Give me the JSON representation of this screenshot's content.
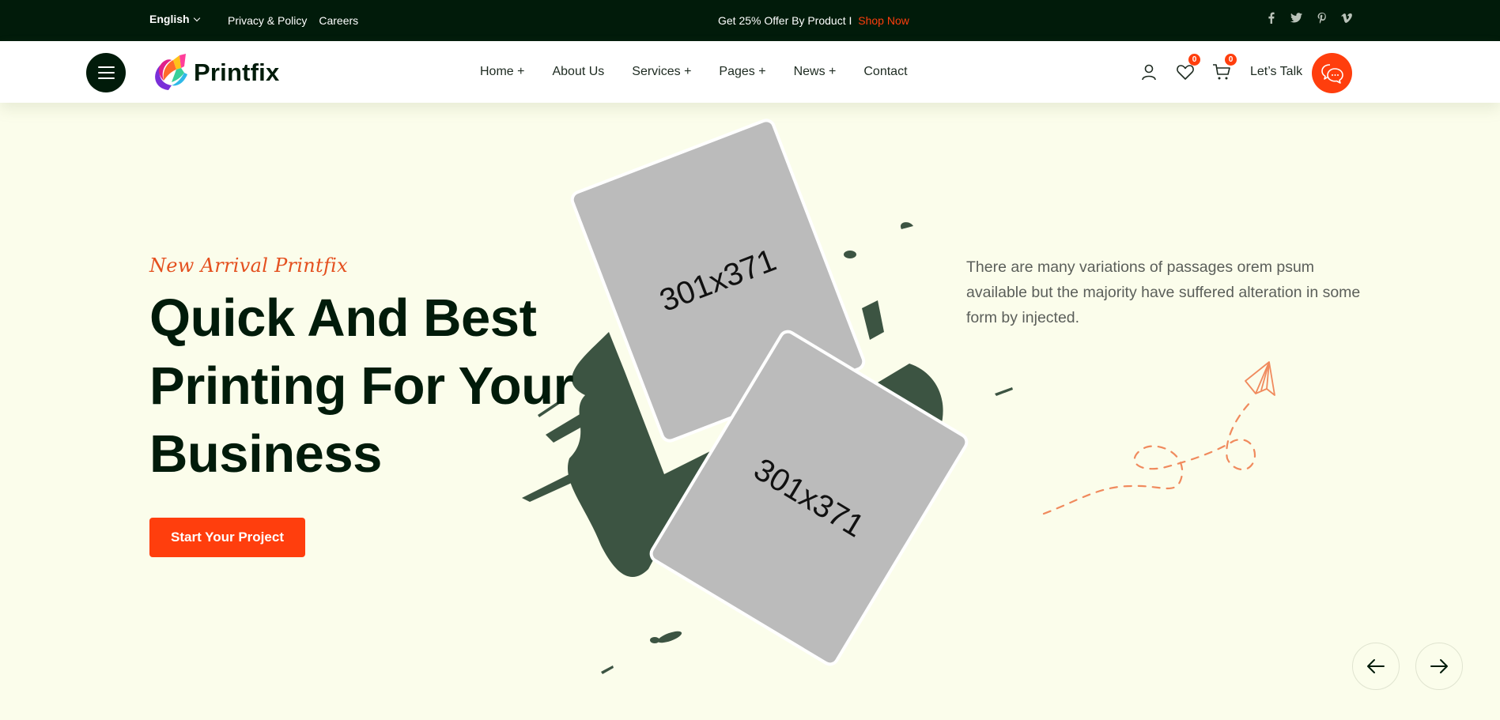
{
  "topbar": {
    "language": "English",
    "links": [
      "Privacy & Policy",
      "Careers"
    ],
    "offer_text": "Get 25% Offer By Product I",
    "offer_link": "Shop Now",
    "social": [
      {
        "name": "facebook-icon",
        "glyph": "f"
      },
      {
        "name": "twitter-icon",
        "glyph": "t"
      },
      {
        "name": "pinterest-icon",
        "glyph": "p"
      },
      {
        "name": "vimeo-icon",
        "glyph": "v"
      }
    ]
  },
  "header": {
    "brand": "Printfix",
    "nav": [
      "Home +",
      "About Us",
      "Services +",
      "Pages +",
      "News +",
      "Contact"
    ],
    "wishlist_count": "0",
    "cart_count": "0",
    "talk_label": "Let’s Talk"
  },
  "hero": {
    "subtitle": "New Arrival Printfix",
    "headline_lines": [
      "Quick And Best",
      "Printing For Your",
      "Business"
    ],
    "cta_label": "Start Your Project",
    "description": "There are many variations of passages orem psum available but the majority have suffered alteration in some form by injected.",
    "card_labels": [
      "301x371",
      "301x371"
    ]
  },
  "colors": {
    "dark": "#011b0a",
    "accent": "#ff3e0d",
    "hero_bg": "#fbfdeb",
    "splash": "#3c5442",
    "placeholder": "#bbbbbb"
  }
}
